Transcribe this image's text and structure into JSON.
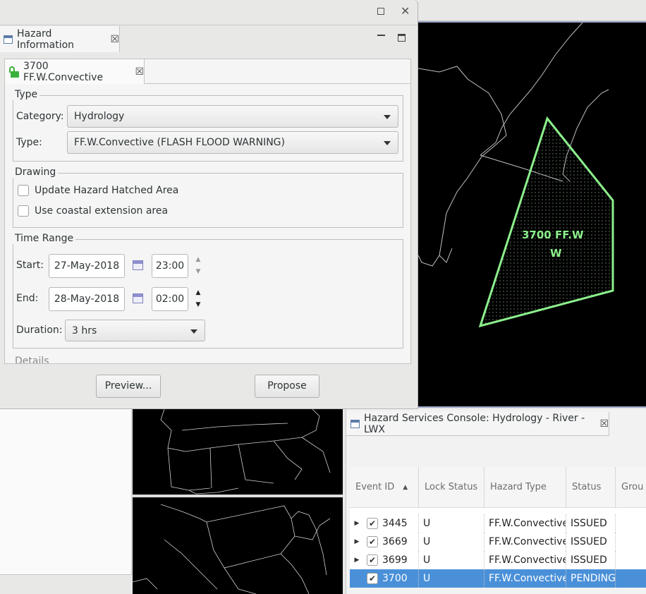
{
  "dialog": {
    "view_tab_title": "Hazard Information",
    "event_tab_title": "3700 FF.W.Convective",
    "type_group": {
      "legend": "Type",
      "category_label": "Category:",
      "category_value": "Hydrology",
      "type_label": "Type:",
      "type_value": "FF.W.Convective (FLASH FLOOD WARNING)"
    },
    "drawing_group": {
      "legend": "Drawing",
      "update_hatched_label": "Update Hazard Hatched Area",
      "coastal_extension_label": "Use coastal extension area"
    },
    "time_range_group": {
      "legend": "Time Range",
      "start_label": "Start:",
      "start_date": "27-May-2018",
      "start_time": "23:00",
      "end_label": "End:",
      "end_date": "28-May-2018",
      "end_time": "02:00",
      "duration_label": "Duration:",
      "duration_value": "3 hrs"
    },
    "cut_off_text": "Details",
    "preview_button": "Preview...",
    "propose_button": "Propose"
  },
  "map": {
    "polygon_label_line1": "3700 FF.W",
    "polygon_label_line2": "W",
    "polygon_color": "#8cf08c"
  },
  "console": {
    "title": "Hazard Services Console: Hydrology - River - LWX",
    "columns": [
      "Event ID",
      "Lock Status",
      "Hazard Type",
      "Status",
      "Grou"
    ],
    "rows": [
      {
        "id": "3445",
        "lock": "U",
        "type": "FF.W.Convective",
        "status": "ISSUED",
        "selected": false
      },
      {
        "id": "3669",
        "lock": "U",
        "type": "FF.W.Convective",
        "status": "ISSUED",
        "selected": false
      },
      {
        "id": "3699",
        "lock": "U",
        "type": "FF.W.Convective",
        "status": "ISSUED",
        "selected": false
      },
      {
        "id": "3700",
        "lock": "U",
        "type": "FF.W.Convective",
        "status": "PENDING",
        "selected": true
      }
    ],
    "selection_color": "#4a90d9"
  }
}
